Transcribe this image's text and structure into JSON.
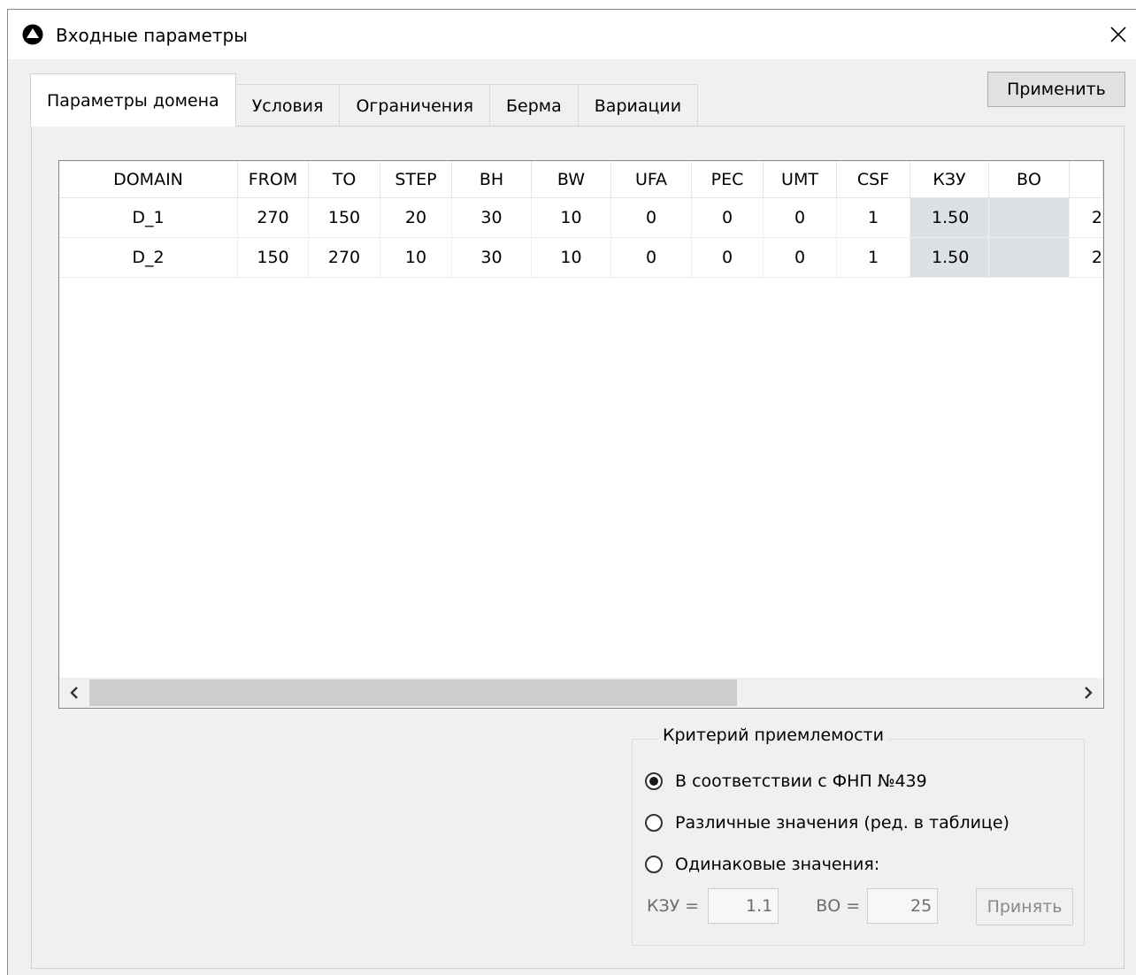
{
  "window": {
    "title": "Входные параметры",
    "close_symbol": "✕"
  },
  "tabs": [
    {
      "label": "Параметры домена",
      "active": true
    },
    {
      "label": "Условия",
      "active": false
    },
    {
      "label": "Ограничения",
      "active": false
    },
    {
      "label": "Берма",
      "active": false
    },
    {
      "label": "Вариации",
      "active": false
    }
  ],
  "toolbar": {
    "apply_label": "Применить"
  },
  "table": {
    "columns": [
      "DOMAIN",
      "FROM",
      "TO",
      "STEP",
      "BH",
      "BW",
      "UFA",
      "PEC",
      "UMT",
      "CSF",
      "КЗУ",
      "ВО",
      ""
    ],
    "rows": [
      [
        "D_1",
        "270",
        "150",
        "20",
        "30",
        "10",
        "0",
        "0",
        "0",
        "1",
        "1.50",
        "",
        "2"
      ],
      [
        "D_2",
        "150",
        "270",
        "10",
        "30",
        "10",
        "0",
        "0",
        "0",
        "1",
        "1.50",
        "",
        "2"
      ]
    ],
    "scrollbar": {
      "left_icon": "chevron-left-icon",
      "right_icon": "chevron-right-icon"
    }
  },
  "criteria": {
    "legend": "Критерий приемлемости",
    "options": [
      {
        "label": "В соответствии с ФНП №439",
        "checked": true
      },
      {
        "label": "Различные значения (ред. в таблице)",
        "checked": false
      },
      {
        "label": "Одинаковые значения:",
        "checked": false
      }
    ],
    "kzu_label": "КЗУ =",
    "kzu_value": "1.1",
    "vo_label": "ВО =",
    "vo_value": "25",
    "accept_label": "Принять"
  },
  "colors": {
    "shaded_cell": "#dde0e4",
    "window_bg": "#f0f0f0"
  }
}
